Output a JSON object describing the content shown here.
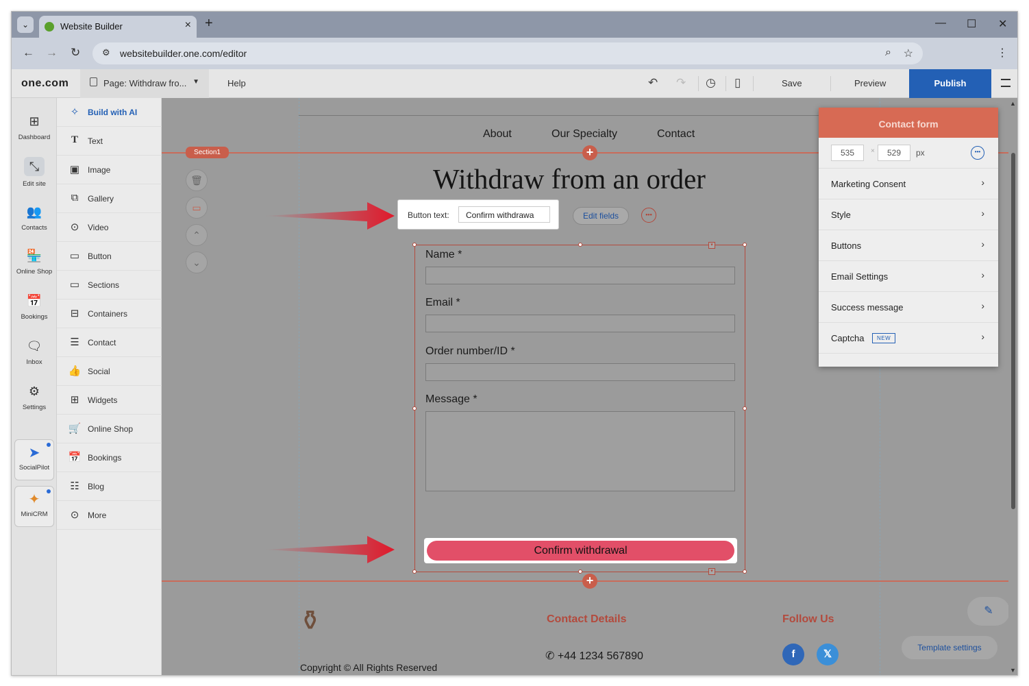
{
  "browser": {
    "tab_title": "Website Builder",
    "url": "websitebuilder.one.com/editor"
  },
  "app": {
    "logo": "one.com",
    "page_prefix": "Page:",
    "page_name": "Withdraw fro...",
    "help": "Help",
    "save": "Save",
    "preview": "Preview",
    "publish": "Publish"
  },
  "rail": [
    {
      "label": "Dashboard",
      "icon": "dashboard-icon"
    },
    {
      "label": "Edit site",
      "icon": "edit-site-icon"
    },
    {
      "label": "Contacts",
      "icon": "contacts-icon"
    },
    {
      "label": "Online Shop",
      "icon": "shop-icon"
    },
    {
      "label": "Bookings",
      "icon": "bookings-icon"
    },
    {
      "label": "Inbox",
      "icon": "inbox-icon"
    },
    {
      "label": "Settings",
      "icon": "settings-icon"
    },
    {
      "label": "SocialPilot",
      "icon": "socialpilot-icon"
    },
    {
      "label": "MiniCRM",
      "icon": "minicrm-icon"
    }
  ],
  "panel": [
    {
      "label": "Build with AI",
      "icon": "sparkle-icon"
    },
    {
      "label": "Text",
      "icon": "text-icon"
    },
    {
      "label": "Image",
      "icon": "image-icon"
    },
    {
      "label": "Gallery",
      "icon": "gallery-icon"
    },
    {
      "label": "Video",
      "icon": "video-icon"
    },
    {
      "label": "Button",
      "icon": "button-icon"
    },
    {
      "label": "Sections",
      "icon": "sections-icon"
    },
    {
      "label": "Containers",
      "icon": "containers-icon"
    },
    {
      "label": "Contact",
      "icon": "contact-icon"
    },
    {
      "label": "Social",
      "icon": "social-icon"
    },
    {
      "label": "Widgets",
      "icon": "widgets-icon"
    },
    {
      "label": "Online Shop",
      "icon": "cart-icon"
    },
    {
      "label": "Bookings",
      "icon": "bookings-icon"
    },
    {
      "label": "Blog",
      "icon": "blog-icon"
    },
    {
      "label": "More",
      "icon": "more-icon"
    }
  ],
  "site": {
    "nav": [
      "About",
      "Our Specialty",
      "Contact"
    ],
    "section_label": "Section1",
    "heading": "Withdraw from an order",
    "button_text_label": "Button text:",
    "button_text_value": "Confirm withdrawa",
    "edit_fields": "Edit fields",
    "form": {
      "fields": [
        "Name *",
        "Email *",
        "Order number/ID *",
        "Message *"
      ],
      "submit": "Confirm withdrawal"
    },
    "footer": {
      "contact_heading": "Contact Details",
      "phone": "+44 1234 567890",
      "follow_heading": "Follow Us",
      "copyright": "Copyright © All Rights Reserved"
    },
    "template_settings": "Template settings"
  },
  "contact_form_panel": {
    "title": "Contact form",
    "width": "535",
    "height": "529",
    "unit": "px",
    "items": [
      "Marketing Consent",
      "Style",
      "Buttons",
      "Email Settings",
      "Success message",
      "Captcha"
    ],
    "captcha_badge": "NEW"
  },
  "colors": {
    "accent": "#2360b5",
    "section": "#c95e4b",
    "submit": "#e24f68",
    "annotation_arrow": "#e0192b"
  }
}
